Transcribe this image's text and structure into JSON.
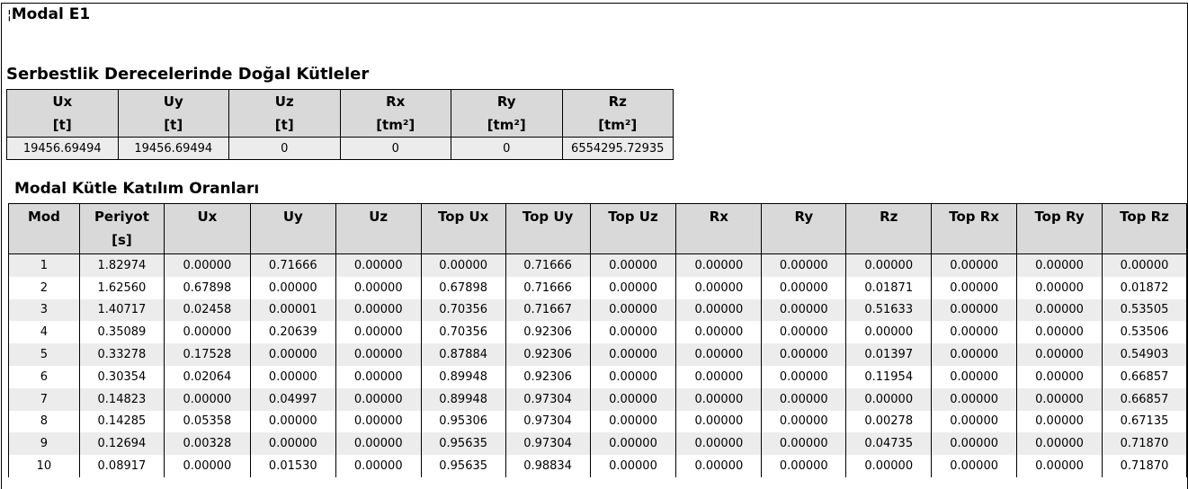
{
  "title": {
    "mark": "¦",
    "text": "Modal E1"
  },
  "masses": {
    "heading": "Serbestlik Derecelerinde Doğal Kütleler",
    "columns": [
      {
        "name": "Ux",
        "unit": "[t]"
      },
      {
        "name": "Uy",
        "unit": "[t]"
      },
      {
        "name": "Uz",
        "unit": "[t]"
      },
      {
        "name": "Rx",
        "unit": "[tm²]"
      },
      {
        "name": "Ry",
        "unit": "[tm²]"
      },
      {
        "name": "Rz",
        "unit": "[tm²]"
      }
    ],
    "values": [
      "19456.69494",
      "19456.69494",
      "0",
      "0",
      "0",
      "6554295.72935"
    ]
  },
  "participation": {
    "heading": "Modal Kütle Katılım Oranları",
    "columns": [
      {
        "name": "Mod",
        "unit": ""
      },
      {
        "name": "Periyot",
        "unit": "[s]"
      },
      {
        "name": "Ux",
        "unit": ""
      },
      {
        "name": "Uy",
        "unit": ""
      },
      {
        "name": "Uz",
        "unit": ""
      },
      {
        "name": "Top Ux",
        "unit": ""
      },
      {
        "name": "Top Uy",
        "unit": ""
      },
      {
        "name": "Top Uz",
        "unit": ""
      },
      {
        "name": "Rx",
        "unit": ""
      },
      {
        "name": "Ry",
        "unit": ""
      },
      {
        "name": "Rz",
        "unit": ""
      },
      {
        "name": "Top Rx",
        "unit": ""
      },
      {
        "name": "Top Ry",
        "unit": ""
      },
      {
        "name": "Top Rz",
        "unit": ""
      }
    ],
    "rows": [
      [
        "1",
        "1.82974",
        "0.00000",
        "0.71666",
        "0.00000",
        "0.00000",
        "0.71666",
        "0.00000",
        "0.00000",
        "0.00000",
        "0.00000",
        "0.00000",
        "0.00000",
        "0.00000"
      ],
      [
        "2",
        "1.62560",
        "0.67898",
        "0.00000",
        "0.00000",
        "0.67898",
        "0.71666",
        "0.00000",
        "0.00000",
        "0.00000",
        "0.01871",
        "0.00000",
        "0.00000",
        "0.01872"
      ],
      [
        "3",
        "1.40717",
        "0.02458",
        "0.00001",
        "0.00000",
        "0.70356",
        "0.71667",
        "0.00000",
        "0.00000",
        "0.00000",
        "0.51633",
        "0.00000",
        "0.00000",
        "0.53505"
      ],
      [
        "4",
        "0.35089",
        "0.00000",
        "0.20639",
        "0.00000",
        "0.70356",
        "0.92306",
        "0.00000",
        "0.00000",
        "0.00000",
        "0.00000",
        "0.00000",
        "0.00000",
        "0.53506"
      ],
      [
        "5",
        "0.33278",
        "0.17528",
        "0.00000",
        "0.00000",
        "0.87884",
        "0.92306",
        "0.00000",
        "0.00000",
        "0.00000",
        "0.01397",
        "0.00000",
        "0.00000",
        "0.54903"
      ],
      [
        "6",
        "0.30354",
        "0.02064",
        "0.00000",
        "0.00000",
        "0.89948",
        "0.92306",
        "0.00000",
        "0.00000",
        "0.00000",
        "0.11954",
        "0.00000",
        "0.00000",
        "0.66857"
      ],
      [
        "7",
        "0.14823",
        "0.00000",
        "0.04997",
        "0.00000",
        "0.89948",
        "0.97304",
        "0.00000",
        "0.00000",
        "0.00000",
        "0.00000",
        "0.00000",
        "0.00000",
        "0.66857"
      ],
      [
        "8",
        "0.14285",
        "0.05358",
        "0.00000",
        "0.00000",
        "0.95306",
        "0.97304",
        "0.00000",
        "0.00000",
        "0.00000",
        "0.00278",
        "0.00000",
        "0.00000",
        "0.67135"
      ],
      [
        "9",
        "0.12694",
        "0.00328",
        "0.00000",
        "0.00000",
        "0.95635",
        "0.97304",
        "0.00000",
        "0.00000",
        "0.00000",
        "0.04735",
        "0.00000",
        "0.00000",
        "0.71870"
      ],
      [
        "10",
        "0.08917",
        "0.00000",
        "0.01530",
        "0.00000",
        "0.95635",
        "0.98834",
        "0.00000",
        "0.00000",
        "0.00000",
        "0.00000",
        "0.00000",
        "0.00000",
        "0.71870"
      ]
    ]
  }
}
